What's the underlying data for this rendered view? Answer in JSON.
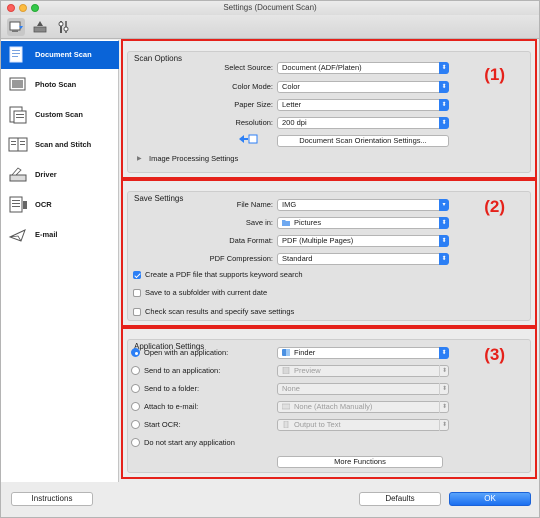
{
  "window": {
    "title": "Settings (Document Scan)"
  },
  "sidebar": {
    "items": [
      {
        "label": "Document Scan",
        "icon": "document-scan-icon",
        "active": true
      },
      {
        "label": "Photo Scan",
        "icon": "photo-scan-icon",
        "active": false
      },
      {
        "label": "Custom Scan",
        "icon": "custom-scan-icon",
        "active": false
      },
      {
        "label": "Scan and Stitch",
        "icon": "scan-and-stitch-icon",
        "active": false
      },
      {
        "label": "Driver",
        "icon": "driver-icon",
        "active": false
      },
      {
        "label": "OCR",
        "icon": "ocr-icon",
        "active": false
      },
      {
        "label": "E-mail",
        "icon": "email-icon",
        "active": false
      }
    ]
  },
  "scan_options": {
    "title": "Scan Options",
    "number": "(1)",
    "select_source_label": "Select Source:",
    "select_source_value": "Document (ADF/Platen)",
    "color_mode_label": "Color Mode:",
    "color_mode_value": "Color",
    "paper_size_label": "Paper Size:",
    "paper_size_value": "Letter",
    "resolution_label": "Resolution:",
    "resolution_value": "200 dpi",
    "orientation_button": "Document Scan Orientation Settings...",
    "image_processing_label": "Image Processing Settings"
  },
  "save_settings": {
    "title": "Save Settings",
    "number": "(2)",
    "file_name_label": "File Name:",
    "file_name_value": "IMG",
    "save_in_label": "Save in:",
    "save_in_value": "Pictures",
    "data_format_label": "Data Format:",
    "data_format_value": "PDF (Multiple Pages)",
    "pdf_compression_label": "PDF Compression:",
    "pdf_compression_value": "Standard",
    "checkbox_keyword": "Create a PDF file that supports keyword search",
    "checkbox_subfolder": "Save to a subfolder with current date",
    "checkbox_check_results": "Check scan results and specify save settings"
  },
  "application_settings": {
    "title": "Application Settings",
    "number": "(3)",
    "open_with_label": "Open with an application:",
    "open_with_value": "Finder",
    "send_to_app_label": "Send to an application:",
    "send_to_app_value": "Preview",
    "send_to_folder_label": "Send to a folder:",
    "send_to_folder_value": "None",
    "attach_email_label": "Attach to e-mail:",
    "attach_email_value": "None (Attach Manually)",
    "start_ocr_label": "Start OCR:",
    "start_ocr_value": "Output to Text",
    "no_app_label": "Do not start any application",
    "more_functions_button": "More Functions"
  },
  "footer": {
    "instructions_button": "Instructions",
    "defaults_button": "Defaults",
    "ok_button": "OK"
  },
  "colors": {
    "highlight_red": "#e5211a",
    "accent_blue": "#2c7ff5",
    "sidebar_active": "#0a64d8"
  }
}
